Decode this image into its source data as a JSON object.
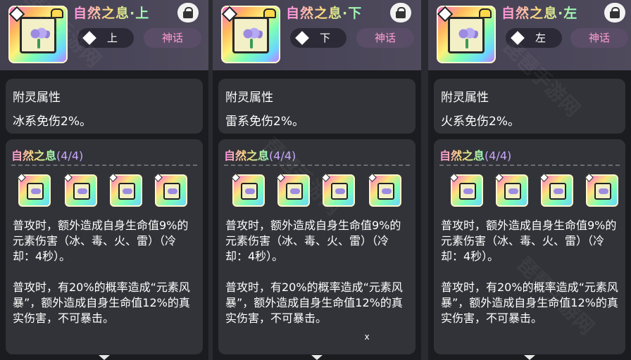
{
  "panels": [
    {
      "title": "自然之息·上",
      "slot_label": "上",
      "rarity": "神话",
      "attr_title": "附灵属性",
      "attr_value": "冰系免伤2%。",
      "set_name": "自然之息",
      "set_count": "(4/4)",
      "effect1": "普攻时，额外造成自身生命值9%的元素伤害（冰、毒、火、雷）（冷却：4秒）。",
      "effect2": "普攻时，有20%的概率造成“元素风暴”，额外造成自身生命值12%的真实伤害，不可暴击。",
      "icons": [
        "lock-icon",
        "rune-icon",
        "slot-up-icon"
      ]
    },
    {
      "title": "自然之息·下",
      "slot_label": "下",
      "rarity": "神话",
      "attr_title": "附灵属性",
      "attr_value": "雷系免伤2%。",
      "set_name": "自然之息",
      "set_count": "(4/4)",
      "effect1": "普攻时，额外造成自身生命值9%的元素伤害（冰、毒、火、雷）（冷却：4秒）。",
      "effect2": "普攻时，有20%的概率造成“元素风暴”，额外造成自身生命值12%的真实伤害，不可暴击。",
      "icons": [
        "lock-icon",
        "rune-icon",
        "slot-down-icon"
      ]
    },
    {
      "title": "自然之息·左",
      "slot_label": "左",
      "rarity": "神话",
      "attr_title": "附灵属性",
      "attr_value": "火系免伤2%。",
      "set_name": "自然之息",
      "set_count": "(4/4)",
      "effect1": "普攻时，额外造成自身生命值9%的元素伤害（冰、毒、火、雷）（冷却：4秒）。",
      "effect2": "普攻时，有20%的概率造成“元素风暴”，额外造成自身生命值12%的真实伤害，不可暴击。",
      "icons": [
        "lock-icon",
        "rune-icon",
        "slot-left-icon"
      ]
    }
  ],
  "close_label": "x",
  "watermark": "琵琶手游网",
  "colors": {
    "panel_bg": "#1b1c1f",
    "section_bg": "#323338",
    "header_bg": "#4a4659",
    "rarity_text": "#ff9ecf",
    "set_count": "#c9a6ff"
  }
}
